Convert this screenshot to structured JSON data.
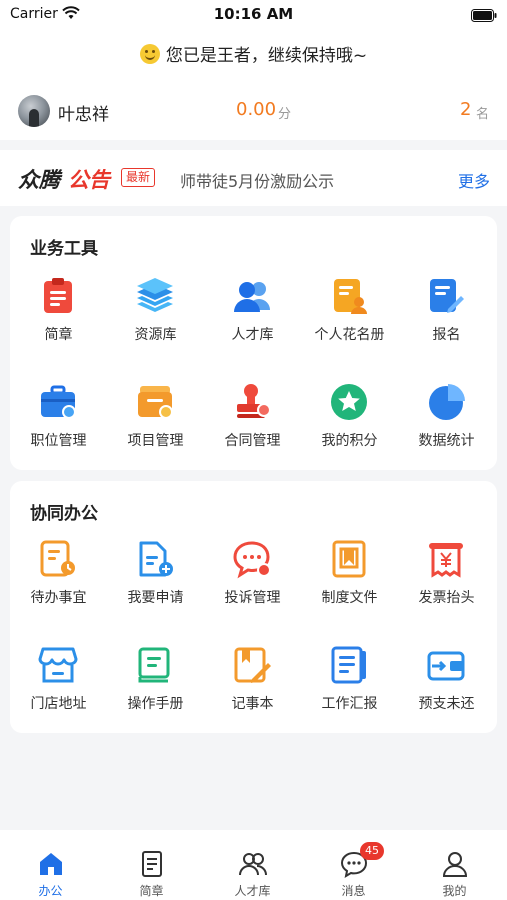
{
  "status": {
    "carrier": "Carrier",
    "time": "10:16 AM"
  },
  "greeting": "您已是王者，继续保持哦~",
  "user": {
    "name": "叶忠祥",
    "score": "0.00",
    "score_unit": "分",
    "rank": "2",
    "rank_unit": "名"
  },
  "notice": {
    "brand_a": "众腾",
    "brand_b": "公告",
    "tag": "最新",
    "text": "师带徒5月份激励公示",
    "more": "更多"
  },
  "business_tools": {
    "title": "业务工具",
    "items": [
      {
        "label": "简章",
        "icon": "brochure-icon"
      },
      {
        "label": "资源库",
        "icon": "layers-icon"
      },
      {
        "label": "人才库",
        "icon": "people-icon"
      },
      {
        "label": "个人花名册",
        "icon": "roster-icon"
      },
      {
        "label": "报名",
        "icon": "signup-icon"
      },
      {
        "label": "职位管理",
        "icon": "briefcase-icon"
      },
      {
        "label": "项目管理",
        "icon": "folder-icon"
      },
      {
        "label": "合同管理",
        "icon": "stamp-icon"
      },
      {
        "label": "我的积分",
        "icon": "star-icon"
      },
      {
        "label": "数据统计",
        "icon": "pie-chart-icon"
      }
    ]
  },
  "collab_office": {
    "title": "协同办公",
    "items": [
      {
        "label": "待办事宜",
        "icon": "todo-icon"
      },
      {
        "label": "我要申请",
        "icon": "apply-icon"
      },
      {
        "label": "投诉管理",
        "icon": "complaint-icon"
      },
      {
        "label": "制度文件",
        "icon": "policy-icon"
      },
      {
        "label": "发票抬头",
        "icon": "invoice-icon"
      },
      {
        "label": "门店地址",
        "icon": "store-icon"
      },
      {
        "label": "操作手册",
        "icon": "manual-icon"
      },
      {
        "label": "记事本",
        "icon": "notepad-icon"
      },
      {
        "label": "工作汇报",
        "icon": "report-icon"
      },
      {
        "label": "预支未还",
        "icon": "wallet-icon"
      }
    ]
  },
  "tabbar": {
    "items": [
      {
        "label": "办公",
        "icon": "home-icon",
        "active": true
      },
      {
        "label": "简章",
        "icon": "document-icon"
      },
      {
        "label": "人才库",
        "icon": "talent-icon"
      },
      {
        "label": "消息",
        "icon": "message-icon",
        "badge": "45"
      },
      {
        "label": "我的",
        "icon": "profile-icon"
      }
    ]
  },
  "colors": {
    "accent": "#1f6fe6",
    "score": "#f27b21",
    "brand_red": "#e8372c"
  }
}
